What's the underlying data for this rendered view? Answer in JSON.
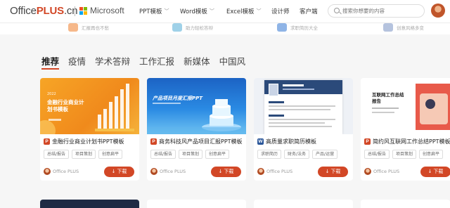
{
  "header": {
    "logo_prefix": "Office",
    "logo_plus": "PLUS",
    "logo_suffix": ".cn",
    "partner": "Microsoft",
    "nav": [
      {
        "label": "PPT模板",
        "dropdown": true
      },
      {
        "label": "Word模板",
        "dropdown": true
      },
      {
        "label": "Excel模板",
        "dropdown": true
      },
      {
        "label": "设计师",
        "dropdown": false
      },
      {
        "label": "客户端",
        "dropdown": false
      }
    ],
    "search_placeholder": "搜索你想要的内容"
  },
  "strip": [
    {
      "text": "汇报再也不愁",
      "icon": "report-icon",
      "color": "#f6b88a"
    },
    {
      "text": "助力轻松答辩",
      "icon": "graduate-icon",
      "color": "#9fd1e8"
    },
    {
      "text": "求职简历大全",
      "icon": "resume-icon",
      "color": "#8fb4e6"
    },
    {
      "text": "创意风格多变",
      "icon": "creative-icon",
      "color": "#b5c3de"
    }
  ],
  "tabs": [
    "推荐",
    "疫情",
    "学术答辩",
    "工作汇报",
    "新媒体",
    "中国风"
  ],
  "active_tab": "推荐",
  "cards": [
    {
      "type": "P",
      "title": "金融行业商业计划书PPT模板",
      "tags": [
        "总结/报告",
        "项目策划",
        "创意扁平"
      ],
      "author": "Office PLUS",
      "download": "下载",
      "thumb_title": "金融行业商业计划书模板",
      "thumb_year": "2022"
    },
    {
      "type": "P",
      "title": "商务科技风产品项目汇报PPT模板",
      "tags": [
        "总结/报告",
        "项目策划",
        "创意扁平"
      ],
      "author": "Office PLUS",
      "download": "下载",
      "thumb_title": "产品项目月度汇报PPT"
    },
    {
      "type": "W",
      "title": "高质量求职简历模板",
      "tags": [
        "求职简历",
        "财务/法务",
        "产品/运营"
      ],
      "author": "Office PLUS",
      "download": "下载"
    },
    {
      "type": "P",
      "title": "简约风互联网工作总结PPT模板",
      "tags": [
        "总结/报告",
        "项目策划",
        "创意扁平"
      ],
      "author": "Office PLUS",
      "download": "下载",
      "thumb_title": "互联网工作总结报告"
    }
  ],
  "colors": {
    "accent": "#d24726",
    "ppt_badge": "#d24726",
    "word_badge": "#2b579a"
  }
}
